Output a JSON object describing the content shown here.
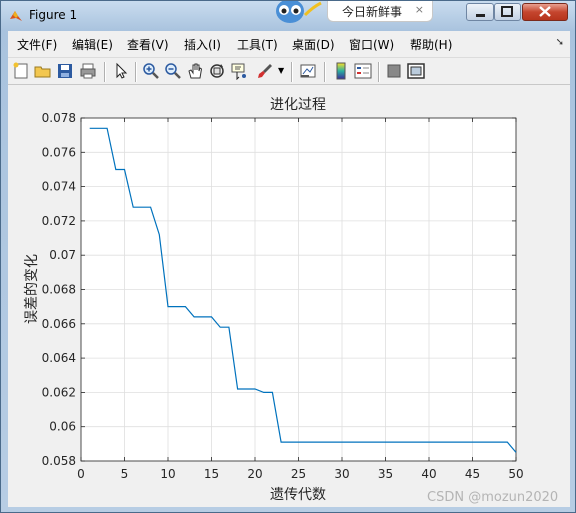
{
  "window": {
    "title": "Figure 1"
  },
  "notification": {
    "text": "今日新鲜事",
    "close": "×"
  },
  "menu": [
    {
      "key": "file",
      "label": "文件(F)"
    },
    {
      "key": "edit",
      "label": "编辑(E)"
    },
    {
      "key": "view",
      "label": "查看(V)"
    },
    {
      "key": "insert",
      "label": "插入(I)"
    },
    {
      "key": "tools",
      "label": "工具(T)"
    },
    {
      "key": "desktop",
      "label": "桌面(D)"
    },
    {
      "key": "window",
      "label": "窗口(W)"
    },
    {
      "key": "help",
      "label": "帮助(H)"
    }
  ],
  "toolbar_icons": [
    "new-figure-icon",
    "open-file-icon",
    "save-icon",
    "print-icon",
    "edit-plot-icon",
    "zoom-in-icon",
    "zoom-out-icon",
    "pan-icon",
    "rotate-3d-icon",
    "data-cursor-icon",
    "brush-icon",
    "link-plot-icon",
    "colorbar-icon",
    "legend-icon",
    "hide-plot-tools-icon",
    "show-plot-tools-icon"
  ],
  "chart_data": {
    "type": "line",
    "title": "进化过程",
    "xlabel": "遗传代数",
    "ylabel": "误差的变化",
    "xlim": [
      0,
      50
    ],
    "ylim": [
      0.058,
      0.078
    ],
    "xticks": [
      "0",
      "5",
      "10",
      "15",
      "20",
      "25",
      "30",
      "35",
      "40",
      "45",
      "50"
    ],
    "yticks": [
      "0.058",
      "0.06",
      "0.062",
      "0.064",
      "0.066",
      "0.068",
      "0.07",
      "0.072",
      "0.074",
      "0.076",
      "0.078"
    ],
    "grid": true,
    "line_color": "#0072bd",
    "x": [
      1,
      2,
      3,
      4,
      5,
      6,
      7,
      8,
      9,
      10,
      11,
      12,
      13,
      14,
      15,
      16,
      17,
      18,
      19,
      20,
      21,
      22,
      23,
      24,
      25,
      26,
      27,
      28,
      29,
      30,
      31,
      32,
      33,
      34,
      35,
      36,
      37,
      38,
      39,
      40,
      41,
      42,
      43,
      44,
      45,
      46,
      47,
      48,
      49,
      50
    ],
    "y": [
      0.0774,
      0.0774,
      0.0774,
      0.075,
      0.075,
      0.0728,
      0.0728,
      0.0728,
      0.0712,
      0.067,
      0.067,
      0.067,
      0.0664,
      0.0664,
      0.0664,
      0.0658,
      0.0658,
      0.0622,
      0.0622,
      0.0622,
      0.062,
      0.062,
      0.0591,
      0.0591,
      0.0591,
      0.0591,
      0.0591,
      0.0591,
      0.0591,
      0.0591,
      0.0591,
      0.0591,
      0.0591,
      0.0591,
      0.0591,
      0.0591,
      0.0591,
      0.0591,
      0.0591,
      0.0591,
      0.0591,
      0.0591,
      0.0591,
      0.0591,
      0.0591,
      0.0591,
      0.0591,
      0.0591,
      0.0591,
      0.0585
    ]
  },
  "watermark": "CSDN @mozun2020"
}
